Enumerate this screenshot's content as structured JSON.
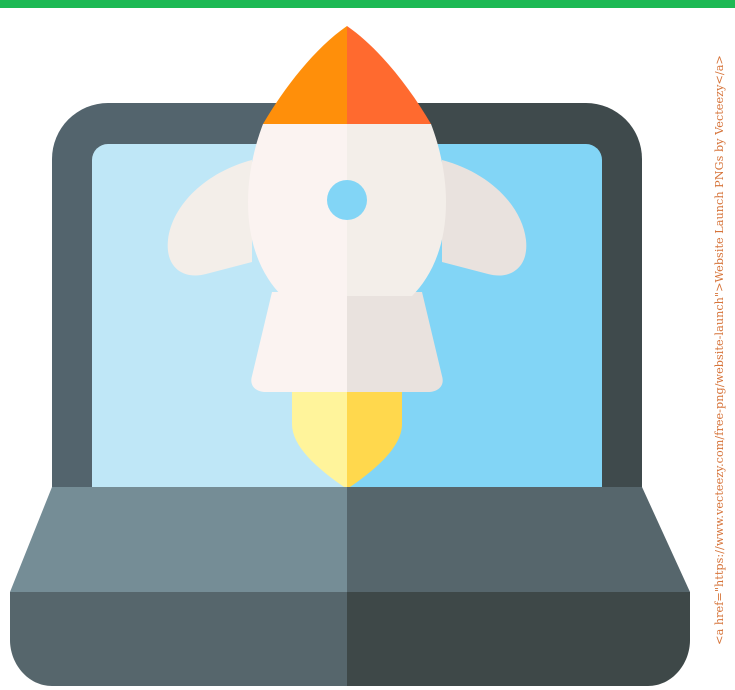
{
  "illustration": {
    "icon": "laptop-rocket-launch-icon"
  },
  "attribution": {
    "text": "<a href=\"https://www.vecteezy.com/free-png/website-launch\">Website Launch PNGs by Vecteezy</a>"
  },
  "colors": {
    "accent_bar": "#1db954",
    "credit_text": "#d6743a",
    "laptop_frame_left": "#53646d",
    "laptop_frame_right": "#3f4a4c",
    "screen_left": "#bfe7f7",
    "screen_right": "#82d5f6",
    "keyboard_deck_left": "#758d96",
    "keyboard_deck_right": "#56666c",
    "base_left": "#56666c",
    "base_right": "#3e4848",
    "rocket_nose_left": "#ff8f0a",
    "rocket_nose_right": "#ff6a2f",
    "rocket_body_left": "#fbf3f1",
    "rocket_body_right": "#f3eee9",
    "rocket_fins_left": "#f3eee9",
    "rocket_fins_right": "#e9e2de",
    "rocket_window": "#82d5f6",
    "flame_left": "#fff49b",
    "flame_right": "#ffd84d"
  }
}
